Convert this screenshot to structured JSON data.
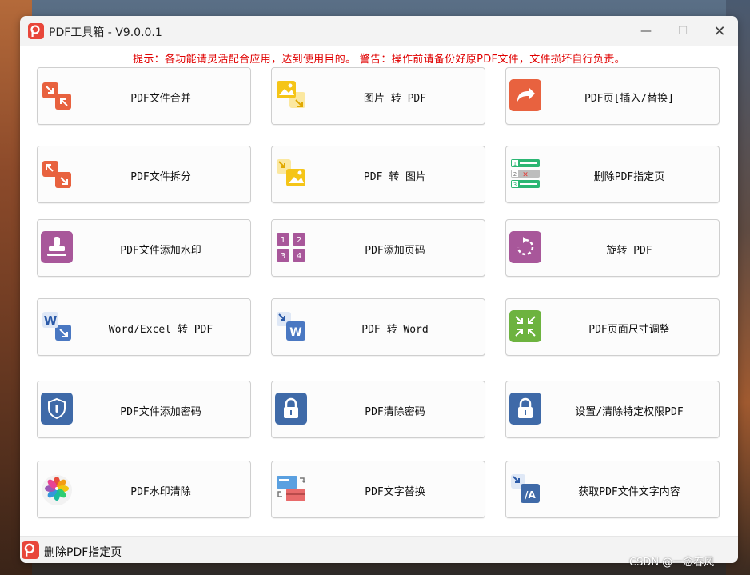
{
  "window": {
    "title": "PDF工具箱 - V9.0.0.1",
    "minimize_glyph": "—",
    "maximize_glyph": "☐",
    "close_glyph": "✕"
  },
  "notice": "提示：各功能请灵活配合应用，达到使用目的。 警告：操作前请备份好原PDF文件，文件损坏自行负责。",
  "tools": [
    {
      "label": "PDF文件合并",
      "icon": "merge-icon",
      "color": "#e8623f"
    },
    {
      "label": "图片 转 PDF",
      "icon": "image-to-pdf-icon",
      "color": "#f5c518"
    },
    {
      "label": "PDF页[插入/替换]",
      "icon": "share-arrow-icon",
      "color": "#e8623f"
    },
    {
      "label": "PDF文件拆分",
      "icon": "split-icon",
      "color": "#e8623f"
    },
    {
      "label": "PDF 转 图片",
      "icon": "pdf-to-image-icon",
      "color": "#f5c518"
    },
    {
      "label": "删除PDF指定页",
      "icon": "delete-page-icon",
      "color": "#2bb673"
    },
    {
      "label": "PDF文件添加水印",
      "icon": "stamp-icon",
      "color": "#a8579a"
    },
    {
      "label": "PDF添加页码",
      "icon": "page-number-icon",
      "color": "#a8579a"
    },
    {
      "label": "旋转 PDF",
      "icon": "rotate-icon",
      "color": "#a8579a"
    },
    {
      "label": "Word/Excel 转 PDF",
      "icon": "word-to-pdf-icon",
      "color": "#4a78c2"
    },
    {
      "label": "PDF 转 Word",
      "icon": "pdf-to-word-icon",
      "color": "#4a78c2"
    },
    {
      "label": "PDF页面尺寸调整",
      "icon": "resize-icon",
      "color": "#6db33f"
    },
    {
      "label": "PDF文件添加密码",
      "icon": "shield-icon",
      "color": "#3f6aa8"
    },
    {
      "label": "PDF清除密码",
      "icon": "lock-icon",
      "color": "#3f6aa8"
    },
    {
      "label": "设置/清除特定权限PDF",
      "icon": "lock-icon",
      "color": "#3f6aa8"
    },
    {
      "label": "PDF水印清除",
      "icon": "flower-icon",
      "color": "#e84d3d"
    },
    {
      "label": "PDF文字替换",
      "icon": "card-swap-icon",
      "color": "#5aa0e0"
    },
    {
      "label": "获取PDF文件文字内容",
      "icon": "text-extract-icon",
      "color": "#3f6aa8"
    }
  ],
  "status": {
    "text": "删除PDF指定页"
  },
  "watermark": "CSDN @一念春风",
  "icon_glyphs": {
    "word": "W",
    "text_extract": "/A",
    "page_numbers": [
      "1",
      "2",
      "3",
      "4"
    ],
    "delete_rows": [
      "1",
      "2",
      "3"
    ],
    "delete_mark": "✕"
  }
}
